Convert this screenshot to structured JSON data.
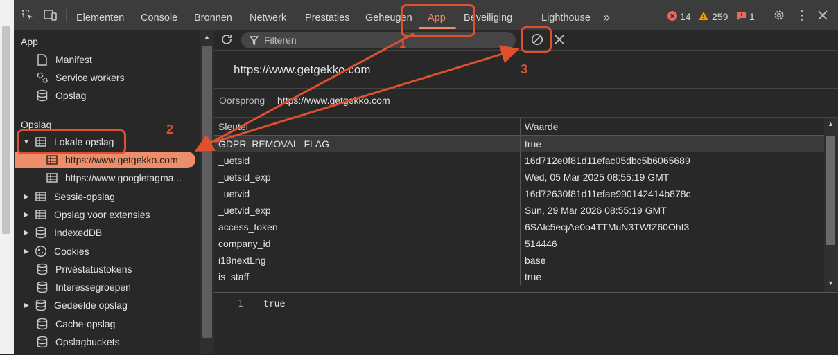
{
  "toolbar": {
    "tabs": [
      "Elementen",
      "Console",
      "Bronnen",
      "Netwerk",
      "Prestaties",
      "Geheugen",
      "App",
      "Beveiliging",
      "Lighthouse"
    ],
    "more_tabs": "»",
    "errors": "14",
    "warnings": "259",
    "issues": "1"
  },
  "sidebar": {
    "app_section": "App",
    "app_items": [
      "Manifest",
      "Service workers",
      "Opslag"
    ],
    "storage_section": "Opslag",
    "local_storage": "Lokale opslag",
    "local_children": [
      "https://www.getgekko.com",
      "https://www.googletagma..."
    ],
    "storage_items": [
      "Sessie-opslag",
      "Opslag voor extensies",
      "IndexedDB",
      "Cookies",
      "Privéstatustokens",
      "Interessegroepen",
      "Gedeelde opslag",
      "Cache-opslag",
      "Opslagbuckets"
    ]
  },
  "main": {
    "filter_placeholder": "Filteren",
    "origin_title": "https://www.getgekko.com",
    "origin_label": "Oorsprong",
    "origin_value": "https://www.getgekko.com",
    "columns": {
      "key": "Sleutel",
      "value": "Waarde"
    },
    "rows": [
      [
        "GDPR_REMOVAL_FLAG",
        "true"
      ],
      [
        "_uetsid",
        "16d712e0f81d11efac05dbc5b6065689"
      ],
      [
        "_uetsid_exp",
        "Wed, 05 Mar 2025 08:55:19 GMT"
      ],
      [
        "_uetvid",
        "16d72630f81d11efae990142414b878c"
      ],
      [
        "_uetvid_exp",
        "Sun, 29 Mar 2026 08:55:19 GMT"
      ],
      [
        "access_token",
        "6SAlc5ecjAe0o4TTMuN3TWfZ60OhI3"
      ],
      [
        "company_id",
        "514446"
      ],
      [
        "i18nextLng",
        "base"
      ],
      [
        "is_staff",
        "true"
      ]
    ],
    "preview_line_no": "1",
    "preview_value": "true"
  },
  "annotations": {
    "n1": "1",
    "n2": "2",
    "n3": "3"
  },
  "colors": {
    "accent": "#f08b6a",
    "annotation": "#e0502f",
    "selected": "#ee8d6a"
  }
}
